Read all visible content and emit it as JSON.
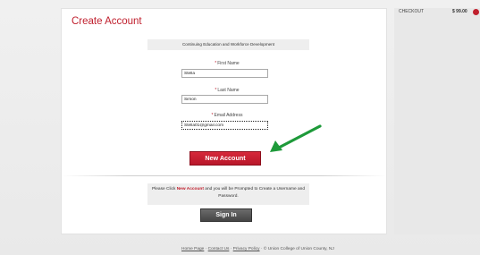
{
  "page": {
    "title": "Create Account",
    "subtitle": "Continuing Education and Workforce Development"
  },
  "form": {
    "required_marker": "*",
    "first_name": {
      "label": "First Name",
      "value": "Stella"
    },
    "last_name": {
      "label": "Last Name",
      "value": "Simon"
    },
    "email": {
      "label": "Email Address",
      "value": "Stella01@gmail.com"
    },
    "submit_label": "New Account"
  },
  "prompt": {
    "before": "Please Click ",
    "highlight": "New Account",
    "after": " and you will be Prompted to Create a Username and Password."
  },
  "signin_label": "Sign In",
  "cart": {
    "label": "CHECKOUT",
    "amount": "$ 99.00"
  },
  "footer": {
    "links": [
      "Home Page",
      "Contact Us",
      "Privacy Policy"
    ],
    "separator": "·",
    "copyright": "© Union College of Union County, NJ"
  },
  "colors": {
    "brand_red": "#c0202e",
    "arrow_green": "#1e9a3a"
  },
  "icons": {
    "cart": "cart-icon",
    "annotation": "green-arrow-icon"
  }
}
